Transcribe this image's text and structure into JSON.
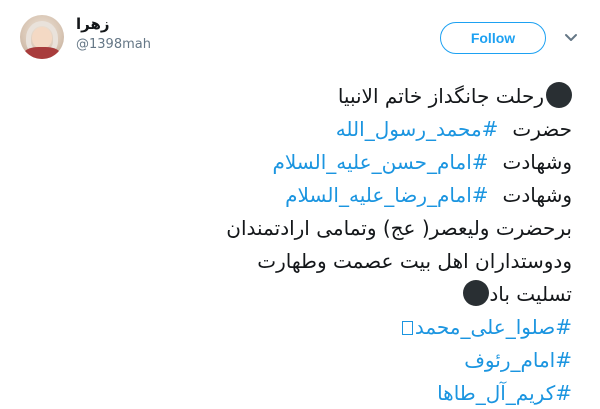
{
  "header": {
    "display_name": "زهرا",
    "handle": "@1398mah",
    "follow_label": "Follow",
    "more_icon": "chevron-down-icon",
    "avatar_icon": "user-avatar"
  },
  "tweet": {
    "line1": "رحلت جانگداز خاتم الانبیا",
    "line2_text": "حضرت",
    "line2_tag": "#محمد_رسول_الله",
    "line3_text": "وشهادت",
    "line3_tag": "#امام_حسن_علیه_السلام",
    "line4_text": "وشهادت",
    "line4_tag": "#امام_رضا_علیه_السلام",
    "line5": "برحضرت ولیعصر( عج) وتمامی ارادتمندان",
    "line6": "ودوستداران اهل بیت عصمت وطهارت",
    "line7": "تسلیت باد",
    "tag8": "#صلوا_علی_محمد",
    "tag9": "#امام_رئوف",
    "tag10": "#کریم_آل_طاها"
  },
  "colors": {
    "accent": "#1da1f2",
    "hashtag": "#1b95e0",
    "text": "#14171a",
    "secondary": "#657786",
    "emoji_dot": "#292f33"
  }
}
